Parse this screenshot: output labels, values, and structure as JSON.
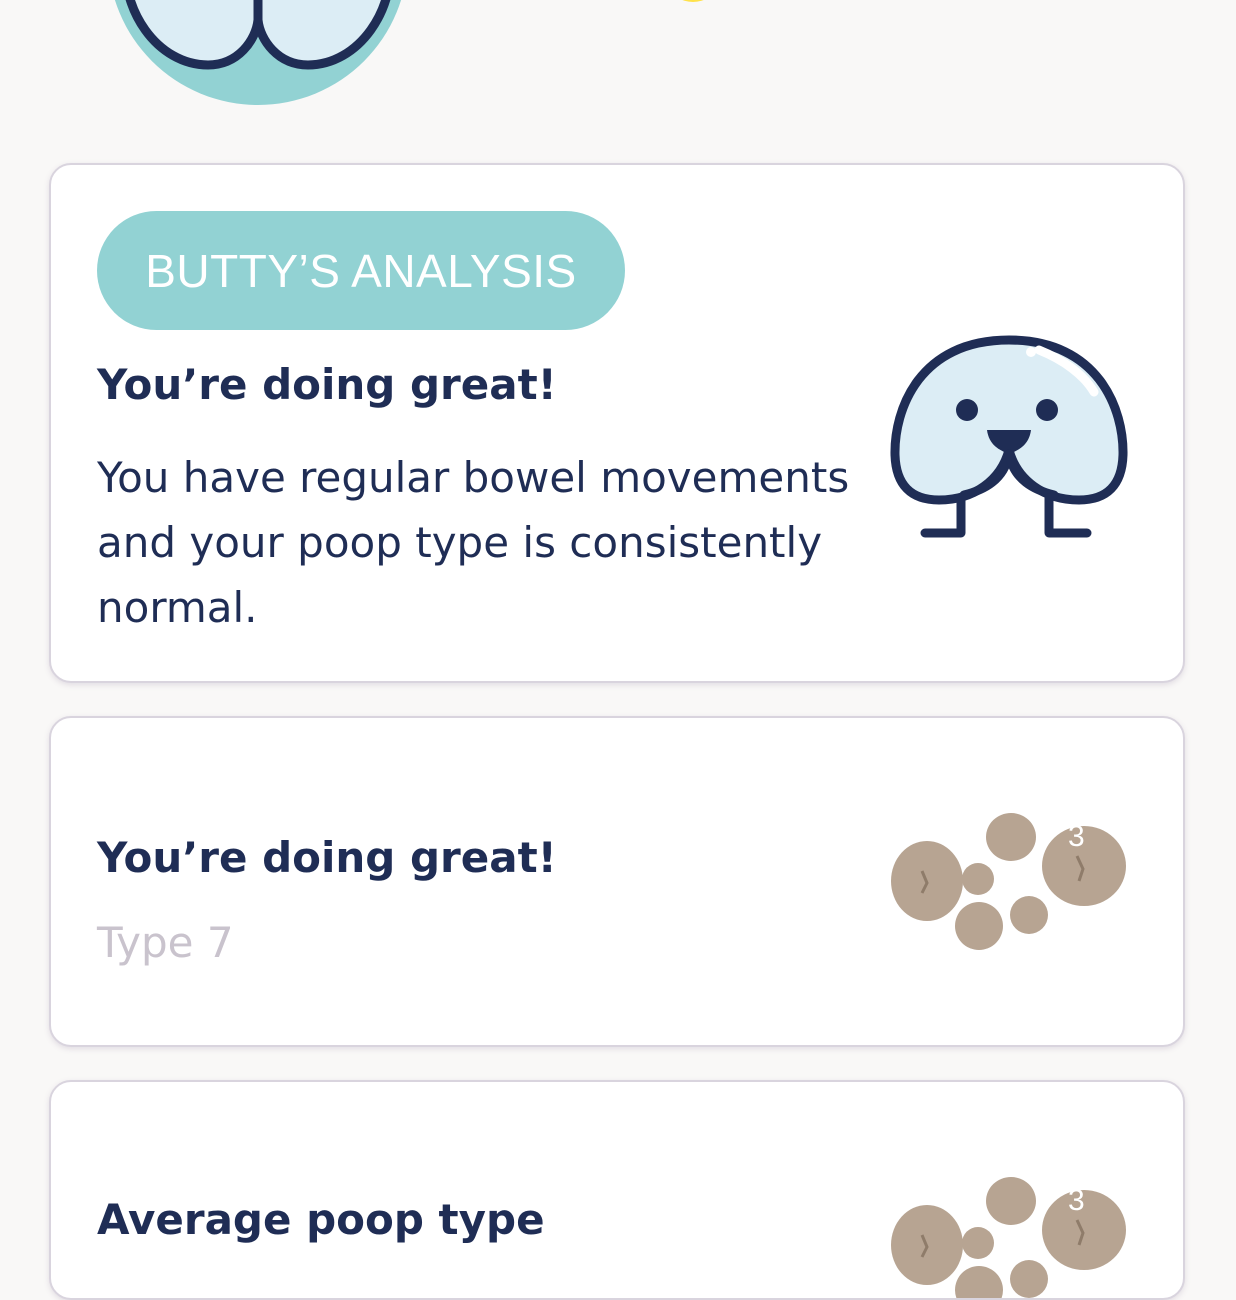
{
  "colors": {
    "background": "#f9f8f7",
    "card_border": "#d9d4de",
    "badge_bg": "#92d2d3",
    "primary_text": "#1f2d55",
    "muted_text": "#c9c3cd",
    "mascot_fill": "#dcedf5",
    "stool_fill": "#b7a492"
  },
  "header": {
    "mascot_icon": "butty-mascot-icon",
    "indicator_icon": "yellow-indicator-icon"
  },
  "analysis_card": {
    "badge_label": "BUTTY’S ANALYSIS",
    "title": "You’re doing great!",
    "body": "You have regular bowel movements and your poop type is consistently normal.",
    "icon": "butty-mascot-icon"
  },
  "status_card": {
    "title": "You’re doing great!",
    "subtitle": "Type 7",
    "icon": "stool-type-icon",
    "icon_number": "3"
  },
  "average_card": {
    "title": "Average poop type",
    "icon": "stool-type-icon",
    "icon_number": "3"
  }
}
